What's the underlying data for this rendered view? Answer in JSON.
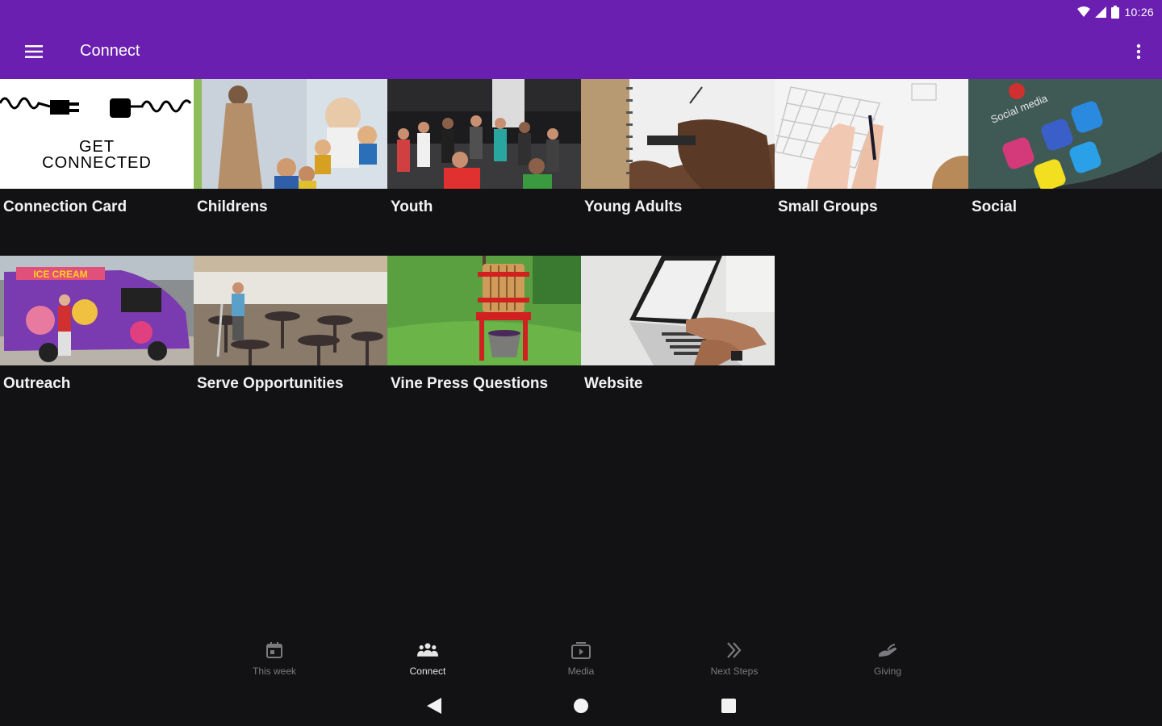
{
  "status_bar": {
    "time": "10:26",
    "icons": [
      "wifi-icon",
      "cell-signal-icon",
      "battery-icon"
    ]
  },
  "app_bar": {
    "title": "Connect",
    "menu_icon": "hamburger-menu-icon",
    "more_icon": "more-vert-icon"
  },
  "tiles": [
    {
      "label": "Connection Card",
      "image_text_1": "GET",
      "image_text_2": "CONNECTED"
    },
    {
      "label": "Childrens"
    },
    {
      "label": "Youth"
    },
    {
      "label": "Young Adults"
    },
    {
      "label": "Small Groups"
    },
    {
      "label": "Social",
      "image_text_1": "Social media"
    },
    {
      "label": "Outreach",
      "image_text_1": "ICE CREAM"
    },
    {
      "label": "Serve Opportunities"
    },
    {
      "label": "Vine Press Questions"
    },
    {
      "label": "Website"
    }
  ],
  "bottom_nav": [
    {
      "label": "This week",
      "icon": "calendar-icon",
      "active": false
    },
    {
      "label": "Connect",
      "icon": "people-icon",
      "active": true
    },
    {
      "label": "Media",
      "icon": "media-icon",
      "active": false
    },
    {
      "label": "Next Steps",
      "icon": "double-chevron-icon",
      "active": false
    },
    {
      "label": "Giving",
      "icon": "giving-hand-icon",
      "active": false
    }
  ],
  "system_nav": [
    "back-icon",
    "home-icon",
    "recents-icon"
  ],
  "colors": {
    "primary": "#6a1fb0",
    "background": "#121214",
    "label": "#f2f2f2",
    "nav_inactive": "#7a7a7e"
  }
}
